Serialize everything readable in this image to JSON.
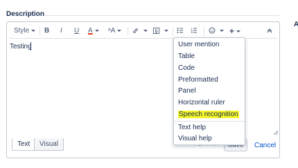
{
  "section": {
    "title": "Description",
    "side_label": "A"
  },
  "toolbar": {
    "style_label": "Style",
    "bold": "B",
    "italic": "I",
    "underline": "U",
    "text_color": "A",
    "text_size": "ᵃA",
    "link": "🔗",
    "attachment": "📎",
    "bullets": "☰",
    "numbered": "☷",
    "emoji": "☺",
    "insert_more": "+",
    "collapse": "˄",
    "text_color_value": "#de350b"
  },
  "editor": {
    "content": "Testing"
  },
  "menu": {
    "items": [
      "User mention",
      "Table",
      "Code",
      "Preformatted",
      "Panel",
      "Horizontal ruler",
      "Speech recognition",
      "Text help",
      "Visual help"
    ],
    "highlight_color": "#f6f72a"
  },
  "footer": {
    "tab_text": "Text",
    "tab_visual": "Visual",
    "undo": "↶",
    "redo": "↷",
    "save": "Save",
    "cancel": "Cancel"
  }
}
